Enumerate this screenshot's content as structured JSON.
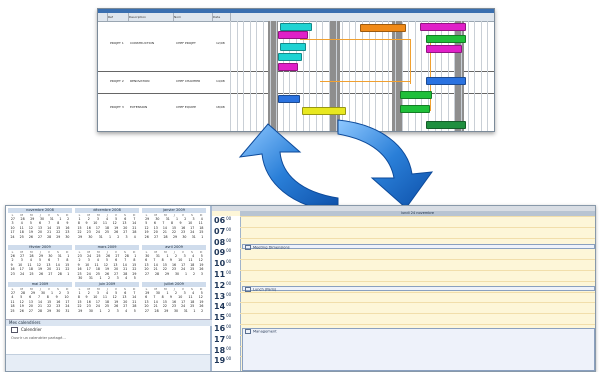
{
  "gantt": {
    "headers": [
      "",
      "Ref",
      "Description",
      "Nom",
      "Date"
    ],
    "rows": [
      {
        "id": "PROJET 1",
        "name": "CONSTRUCTION",
        "owner": "CHEF PROJET",
        "date": "12/08"
      },
      {
        "id": "PROJET 2",
        "name": "RENOVATION",
        "owner": "CHEF CHANTIER",
        "date": "14/08"
      },
      {
        "id": "PROJET 3",
        "name": "EXTENSION",
        "owner": "CHEF EQUIPE",
        "date": "18/08"
      }
    ],
    "colors": {
      "cyan": "#1fd3d3",
      "magenta": "#e020c8",
      "orange": "#f08a18",
      "blue": "#2a72e0",
      "green": "#1fbf3a",
      "yellow": "#e8e820",
      "darkgreen": "#1f8f3f",
      "link": "#f0a030"
    }
  },
  "arrows": {
    "up_arrow_icon": "arrow-up-curved",
    "down_arrow_icon": "arrow-down-curved",
    "color": "#2a7fd8"
  },
  "outlook": {
    "months": [
      {
        "title": "novembre 2008",
        "weeks": [
          "27 28 29 30 31 1 2",
          "3 4 5 6 7 8 9",
          "10 11 12 13 14 15 16",
          "17 18 19 20 21 22 23",
          "24 25 26 27 28 29 30"
        ]
      },
      {
        "title": "décembre 2008",
        "weeks": [
          "1 2 3 4 5 6 7",
          "8 9 10 11 12 13 14",
          "15 16 17 18 19 20 21",
          "22 23 24 25 26 27 28",
          "29 30 31 1 2 3 4"
        ]
      },
      {
        "title": "janvier 2009",
        "weeks": [
          "29 30 31 1 2 3 4",
          "5 6 7 8 9 10 11",
          "12 13 14 15 16 17 18",
          "19 20 21 22 23 24 25",
          "26 27 28 29 30 31 1"
        ]
      },
      {
        "title": "février 2009",
        "weeks": [
          "26 27 28 29 30 31 1",
          "2 3 4 5 6 7 8",
          "9 10 11 12 13 14 15",
          "16 17 18 19 20 21 22",
          "23 24 25 26 27 28 1"
        ]
      },
      {
        "title": "mars 2009",
        "weeks": [
          "23 24 25 26 27 28 1",
          "2 3 4 5 6 7 8",
          "9 10 11 12 13 14 15",
          "16 17 18 19 20 21 22",
          "23 24 25 26 27 28 29",
          "30 31 1 2 3 4 5"
        ]
      },
      {
        "title": "avril 2009",
        "weeks": [
          "30 31 1 2 3 4 5",
          "6 7 8 9 10 11 12",
          "13 14 15 16 17 18 19",
          "20 21 22 23 24 25 26",
          "27 28 29 30 1 2 3"
        ]
      },
      {
        "title": "mai 2009",
        "weeks": [
          "27 28 29 30 1 2 3",
          "4 5 6 7 8 9 10",
          "11 12 13 14 15 16 17",
          "18 19 20 21 22 23 24",
          "25 26 27 28 29 30 31"
        ]
      },
      {
        "title": "juin 2009",
        "weeks": [
          "1 2 3 4 5 6 7",
          "8 9 10 11 12 13 14",
          "15 16 17 18 19 20 21",
          "22 23 24 25 26 27 28",
          "29 30 1 2 3 4 5"
        ]
      },
      {
        "title": "juillet 2009",
        "weeks": [
          "29 30 1 2 3 4 5",
          "6 7 8 9 10 11 12",
          "13 14 15 16 17 18 19",
          "20 21 22 23 24 25 26",
          "27 28 29 30 31 1 2"
        ]
      }
    ],
    "weekday_letters": [
      "L",
      "M",
      "M",
      "J",
      "V",
      "S",
      "D"
    ],
    "my_calendars_label": "Mes calendriers",
    "calendar_item": "Calendrier",
    "share_link": "Ouvrir un calendrier partagé...",
    "day_header": "lundi 24 novembre",
    "hours": [
      "06",
      "07",
      "08",
      "09",
      "10",
      "11",
      "12",
      "13",
      "14",
      "15",
      "16",
      "17",
      "18",
      "19"
    ],
    "minutes": "00",
    "appointments": [
      {
        "label": "Meeting Dimensions"
      },
      {
        "label": "Lunch (Paris)"
      },
      {
        "label": "Management"
      }
    ]
  }
}
